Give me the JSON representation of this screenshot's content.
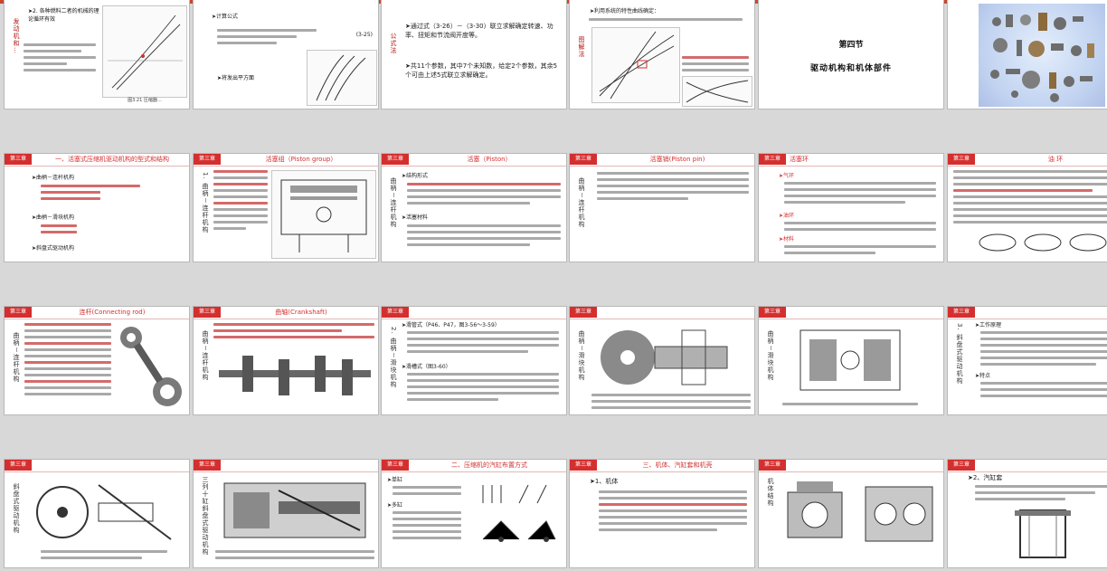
{
  "colors": {
    "accent": "#d42f2f",
    "top_strip": "#c8472e",
    "background": "#d8d8d8"
  },
  "slides": {
    "r1c1": {
      "side": "发动机和…",
      "heading": "➤2. 各种燃料二者的机械的理论循环有效",
      "caption": "图3.21  压缩器…"
    },
    "r1c2": {
      "heading": "➤计算公式",
      "note": "➤将发出平方面",
      "code": "(3-25)"
    },
    "r1c3": {
      "side": "公式法",
      "text": "➤通过式（3-26）－（3-30）联立求解确定转速、功率、扭矩和节流阀开度等。",
      "text2": "➤共11个参数，其中7个未知数，给定2个参数，其余5个可由上述5式联立求解确定。"
    },
    "r1c4": {
      "heading": "➤利用系统的特性曲线确定："
    },
    "r1c5": {
      "section": "第四节",
      "title": "驱动机构和机体部件"
    },
    "r2c1": {
      "tag": "第三章",
      "title": "一、活塞式压缩机驱动机构的型式和结构",
      "b1": "➤曲柄－连杆机构",
      "b2": "➤曲柄－滑块机构",
      "b3": "➤斜盘式驱动机构"
    },
    "r2c2": {
      "tag": "第三章",
      "title": "活塞组（Piston group）",
      "side": "1. 曲柄－连杆机构"
    },
    "r2c3": {
      "tag": "第三章",
      "title": "活塞（Piston）",
      "b1": "➤结构形式",
      "b2": "➤活塞材料",
      "side": "曲柄－连杆机构"
    },
    "r2c4": {
      "tag": "第三章",
      "title": "活塞销(Piston pin)",
      "side": "曲柄－连杆机构"
    },
    "r2c5": {
      "tag": "第三章",
      "title": "活塞环",
      "b1": "➤气环",
      "b2": "➤油环",
      "b3": "➤材料"
    },
    "r2c6": {
      "tag": "第三章",
      "title": "油 环"
    },
    "r3c1": {
      "tag": "第三章",
      "title": "连杆(Connecting rod)",
      "side": "曲柄－连杆机构"
    },
    "r3c2": {
      "tag": "第三章",
      "title": "曲轴(Crankshaft)",
      "side": "曲柄－连杆机构"
    },
    "r3c3": {
      "tag": "第三章",
      "title": "",
      "b1": "➤滑管式（P46、P47，图3-56～3-59）",
      "b2": "➤滑槽式（图3-60）",
      "side": "2. 曲柄－滑块机构"
    },
    "r3c4": {
      "tag": "第三章",
      "side": "曲柄－滑块机构"
    },
    "r3c5": {
      "tag": "第三章",
      "side": "曲柄－滑块机构"
    },
    "r3c6": {
      "tag": "第三章",
      "b1": "➤工作原理",
      "b2": "➤特点",
      "side": "3. 斜盘式驱动机构"
    },
    "r4c1": {
      "tag": "第三章",
      "side": "斜盘式驱动机构"
    },
    "r4c2": {
      "tag": "第三章",
      "side": "三列十缸斜盘式驱动机构"
    },
    "r4c3": {
      "tag": "第三章",
      "title": "二、压缩机的汽缸布置方式",
      "b1": "➤单缸",
      "b2": "➤多缸"
    },
    "r4c4": {
      "tag": "第三章",
      "title": "三、机体、汽缸套和机壳",
      "b1": "➤1、机体"
    },
    "r4c5": {
      "tag": "第三章",
      "side": "机体结构"
    },
    "r4c6": {
      "tag": "第三章",
      "b1": "➤2、汽缸套"
    }
  }
}
